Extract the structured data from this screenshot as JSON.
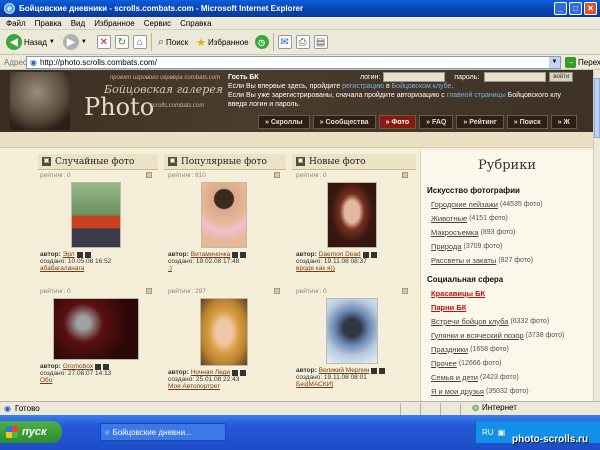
{
  "window": {
    "title": "Бойцовские дневники - scrolls.combats.com - Microsoft Internet Explorer"
  },
  "menu": [
    "Файл",
    "Правка",
    "Вид",
    "Избранное",
    "Сервис",
    "Справка"
  ],
  "toolbar": {
    "back": "Назад",
    "search": "Поиск",
    "favorites": "Избранное"
  },
  "address": {
    "label": "Адрес",
    "url": "http://photo.scrolls.combats.com/",
    "go": "Переход"
  },
  "header": {
    "logo_sub": "проект игрового сервера combats.com",
    "logo_ru": "Бойцовская галерея",
    "logo_photo": "Photo",
    "logo_url": "scrolls.combats.com",
    "guest_title": "Гость БК",
    "guest_line1_a": "Если Вы впервые здесь, пройдите ",
    "guest_line1_link1": "регистрацию",
    "guest_line1_b": " в ",
    "guest_line1_link2": "Бойцовском клубе",
    "guest_line1_c": ".",
    "guest_line2_a": "Если Вы уже зарегистрированы, сначала пройдите авторизацию с ",
    "guest_line2_link": "главной страницы",
    "guest_line2_b": " Бойцовского клу",
    "guest_line3": "введя логин и пароль.",
    "login_label": "логин:",
    "password_label": "пароль:",
    "login_button": "войти"
  },
  "nav": [
    "Скроллы",
    "Сообщества",
    "Фото",
    "FAQ",
    "Рейтинг",
    "Поиск",
    "Ж"
  ],
  "columns": [
    {
      "title": "Случайные фото",
      "cards": [
        {
          "rating": "рейтинг: 0",
          "author": "Эрл",
          "created": "создано: 10.05.08 16:52",
          "caption": "абабагаланага"
        },
        {
          "rating": "рейтинг: 0",
          "author": "Gromobox",
          "created": "создано: 27.08.07 14:13",
          "caption": "Обо"
        }
      ]
    },
    {
      "title": "Популярные фото",
      "cards": [
        {
          "rating": "рейтинг: 810",
          "author": "Витаминочка",
          "created": "создано: 19.02.08 17:48",
          "caption": ":)"
        },
        {
          "rating": "рейтинг: 297",
          "author": "Ночная Леди",
          "created": "создано: 25.01.08 22:43",
          "caption": "Моя Автопортрет"
        }
      ]
    },
    {
      "title": "Новые фото",
      "cards": [
        {
          "rating": "рейтинг: 0",
          "author": "Daemon Dead",
          "created": "создано: 19.11.08 08:37",
          "caption": "вроде как я))"
        },
        {
          "rating": "рейтинг: 0",
          "author": "Великий Мерлин",
          "created": "создано: 19.11.08 08:01",
          "caption": "Без[МАСКИ]"
        }
      ]
    }
  ],
  "card_labels": {
    "author": "автор:"
  },
  "rubrics": {
    "title": "Рубрики",
    "sections": [
      {
        "name": "Искусство фотографии",
        "items": [
          {
            "name": "Городские пейзажи",
            "count": "(44535 фото)",
            "hot": false
          },
          {
            "name": "Животные",
            "count": "(4151 фото)",
            "hot": false
          },
          {
            "name": "Макросъемка",
            "count": "(893 фото)",
            "hot": false
          },
          {
            "name": "Природа",
            "count": "(3709 фото)",
            "hot": false
          },
          {
            "name": "Рассветы и закаты",
            "count": "(827 фото)",
            "hot": false
          }
        ]
      },
      {
        "name": "Социальная сфера",
        "items": [
          {
            "name": "Красавицы БК",
            "count": "",
            "hot": true
          },
          {
            "name": "Парни БК",
            "count": "",
            "hot": true
          },
          {
            "name": "Встречи бойцов клуба",
            "count": "(6332 фото)",
            "hot": false
          },
          {
            "name": "Гулянки и всяческий позор",
            "count": "(3738 фото)",
            "hot": false
          },
          {
            "name": "Праздники",
            "count": "(1658 фото)",
            "hot": false
          },
          {
            "name": "Прочее",
            "count": "(12666 фото)",
            "hot": false
          },
          {
            "name": "Семья и дети",
            "count": "(2423 фото)",
            "hot": false
          },
          {
            "name": "Я и мои друзья",
            "count": "(35032 фото)",
            "hot": false
          }
        ]
      }
    ]
  },
  "status": {
    "text": "Готово",
    "zone": "Интернет"
  },
  "taskbar": {
    "start": "пуск",
    "task": "Бойцовские дневни...",
    "lang": "RU",
    "watermark": "photo-scrolls.ru"
  }
}
